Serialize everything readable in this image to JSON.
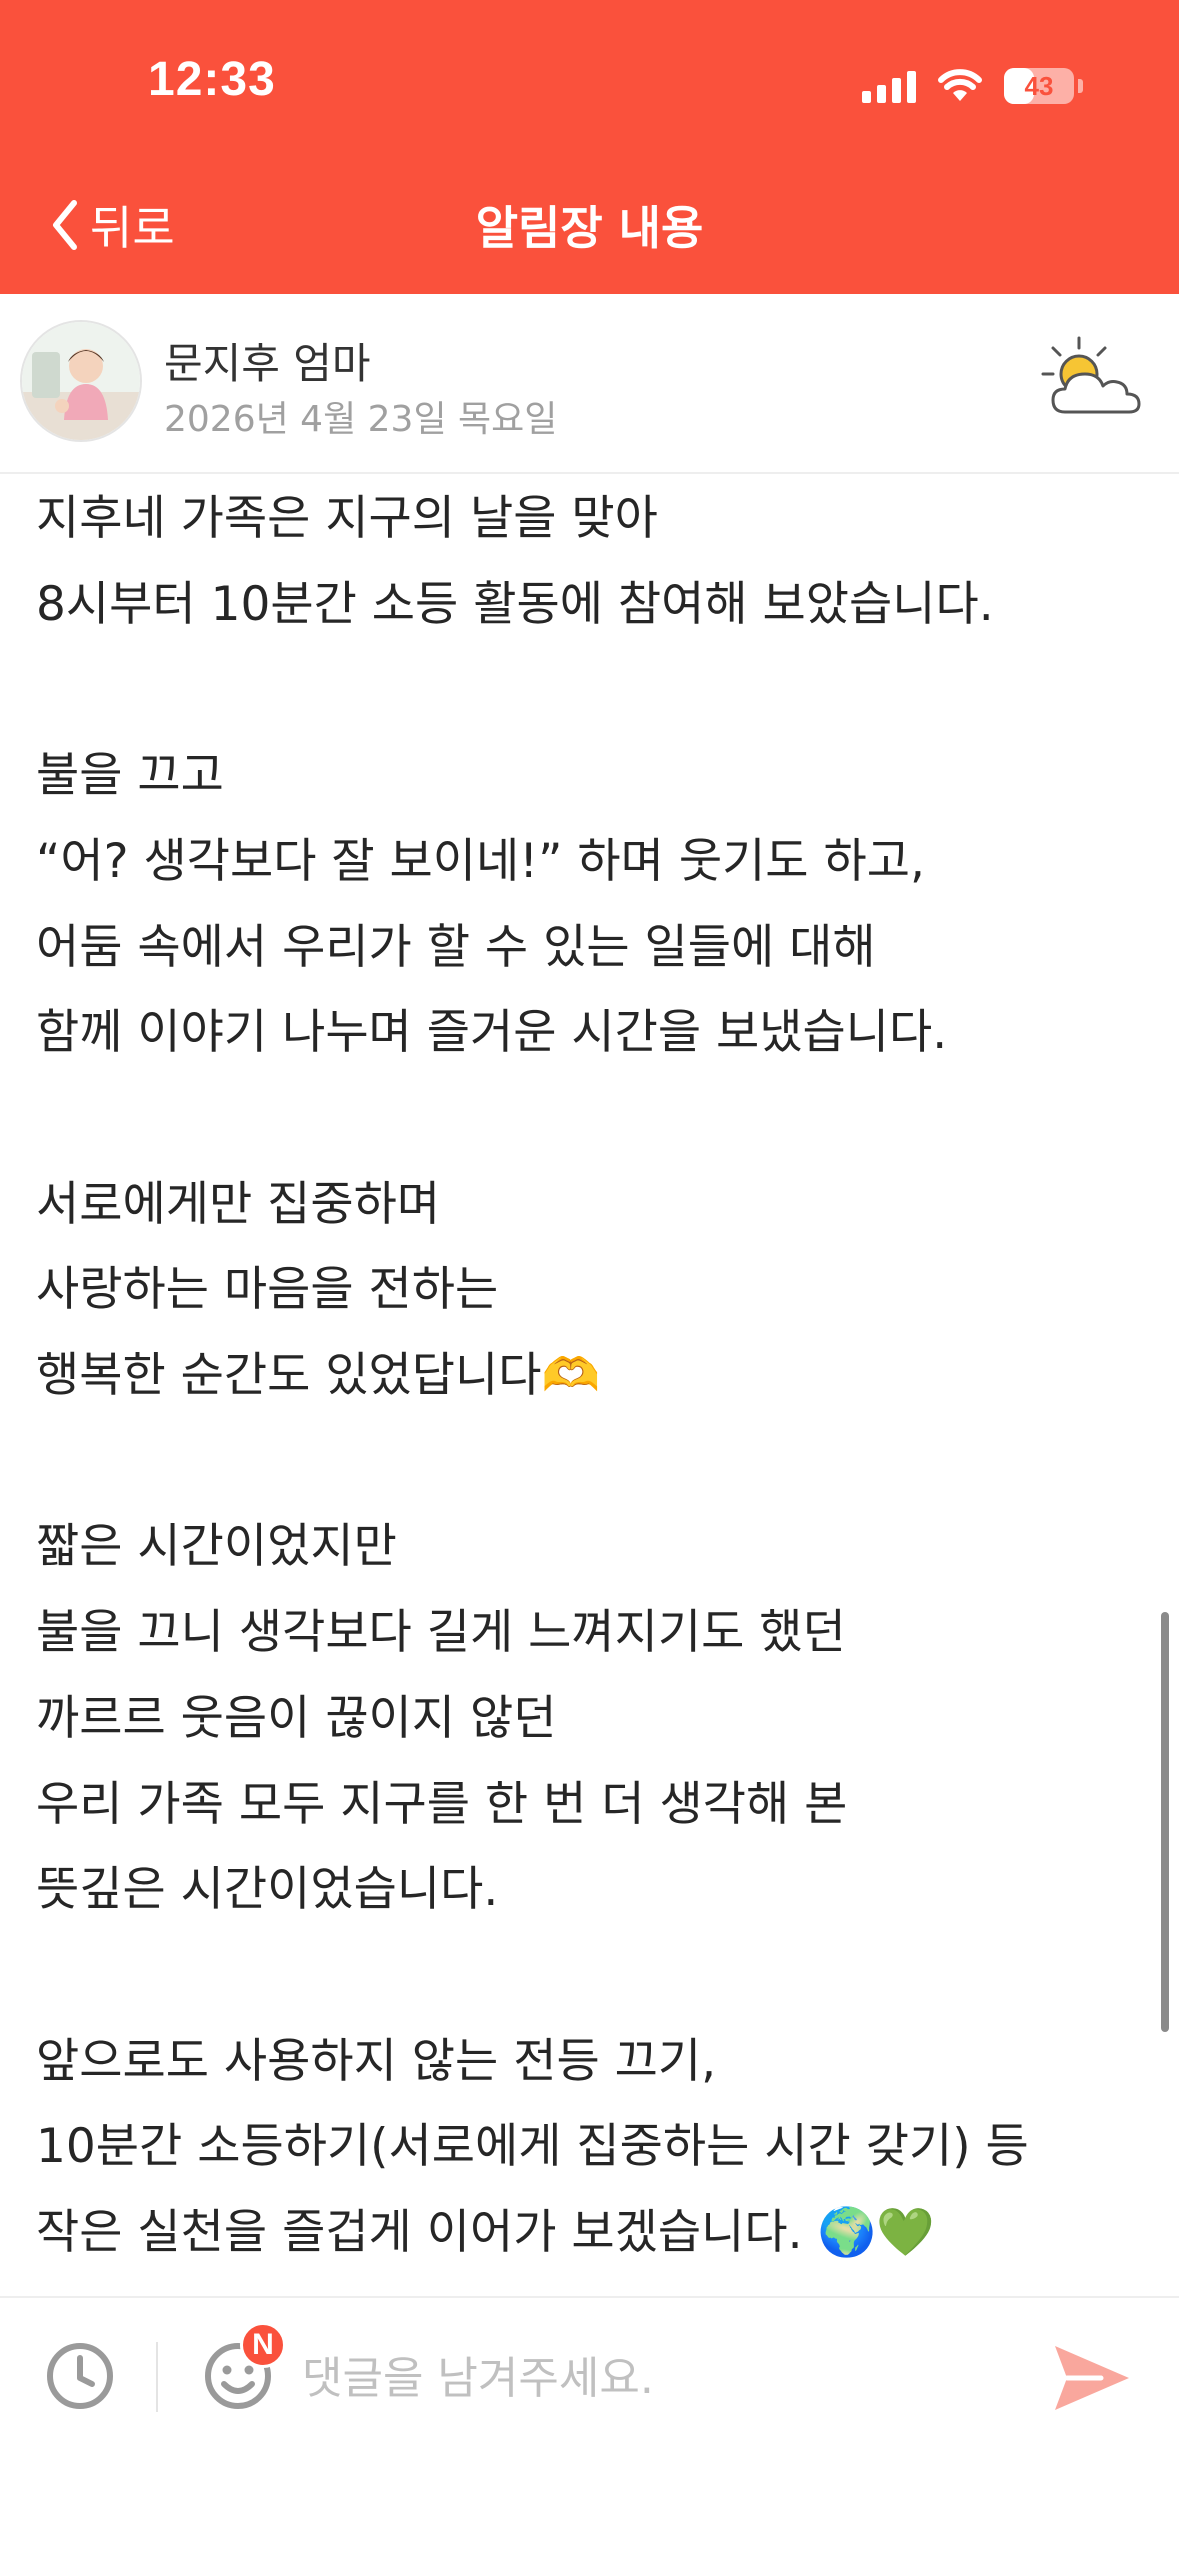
{
  "status_bar": {
    "time": "12:33",
    "battery": "43",
    "battery_level": 0.43
  },
  "nav": {
    "back_label": "뒤로",
    "title": "알림장 내용"
  },
  "author": {
    "name": "문지후 엄마",
    "date": "2026년 4월 23일 목요일",
    "weather_icon": "sun-behind-cloud-icon"
  },
  "post": {
    "body": "지후네 가족은 지구의 날을 맞아\n8시부터 10분간 소등 활동에 참여해 보았습니다.\n\n불을 끄고\n“어? 생각보다 잘 보이네!” 하며 웃기도 하고,\n어둠 속에서 우리가 할 수 있는 일들에 대해\n함께 이야기 나누며 즐거운 시간을 보냈습니다.\n\n서로에게만 집중하며\n사랑하는 마음을 전하는\n행복한 순간도 있었답니다🫶\n\n짧은 시간이었지만\n불을 끄니 생각보다 길게 느껴지기도 했던\n까르르 웃음이 끊이지 않던\n우리 가족 모두 지구를 한 번 더 생각해 본\n뜻깊은 시간이었습니다.\n\n앞으로도 사용하지 않는 전등 끄기,\n10분간 소등하기(서로에게 집중하는 시간 갖기) 등\n작은 실천을 즐겁게 이어가 보겠습니다. 🌍💚"
  },
  "comment_bar": {
    "badge": "N",
    "placeholder": "댓글을 남겨주세요.",
    "value": ""
  },
  "colors": {
    "accent": "#fa513c",
    "send_icon": "#f9a79d",
    "muted_icon": "#9a9a9a"
  }
}
